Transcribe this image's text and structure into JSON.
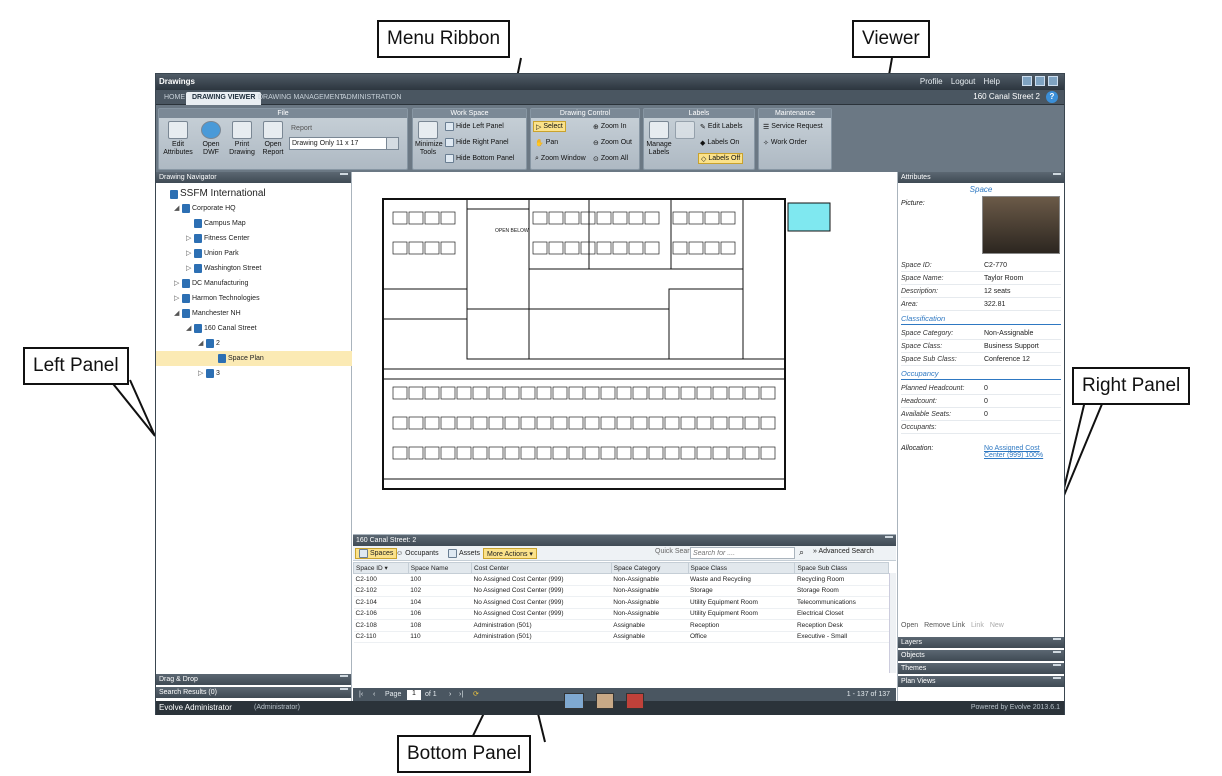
{
  "app": {
    "title": "Drawings",
    "top_links": [
      "Profile",
      "Logout",
      "Help"
    ],
    "tabs": [
      "Home",
      "Drawing Viewer",
      "Drawing Management",
      "Administration"
    ],
    "active_tab": "Drawing Viewer",
    "building_label": "160 Canal Street 2"
  },
  "ribbon": {
    "file": {
      "header": "File",
      "edit": "Edit Attributes",
      "open_dwf": "Open DWF",
      "print": "Print Drawing",
      "open_report": "Open Report",
      "report_label": "Report",
      "report_value": "Drawing Only 11 x 17"
    },
    "workspace": {
      "header": "Work Space",
      "minimize": "Minimize Tools",
      "hide_left": "Hide Left Panel",
      "hide_right": "Hide Right Panel",
      "hide_bottom": "Hide Bottom Panel"
    },
    "drawing_control": {
      "header": "Drawing Control",
      "select": "Select",
      "pan": "Pan",
      "zoom_window": "Zoom Window",
      "zoom_in": "Zoom In",
      "zoom_out": "Zoom Out",
      "zoom_all": "Zoom All"
    },
    "labels": {
      "header": "Labels",
      "manage": "Manage Labels",
      "edit": "Edit Labels",
      "on": "Labels On",
      "off": "Labels Off"
    },
    "maintenance": {
      "header": "Maintenance",
      "service": "Service Request",
      "work_order": "Work Order"
    }
  },
  "left_panel": {
    "header": "Drawing Navigator",
    "tree": [
      {
        "label": "SSFM International",
        "indent": 0,
        "tw": ""
      },
      {
        "label": "Corporate HQ",
        "indent": 1,
        "tw": "◢"
      },
      {
        "label": "Campus Map",
        "indent": 2,
        "tw": ""
      },
      {
        "label": "Fitness Center",
        "indent": 2,
        "tw": "▷"
      },
      {
        "label": "Union Park",
        "indent": 2,
        "tw": "▷"
      },
      {
        "label": "Washington Street",
        "indent": 2,
        "tw": "▷"
      },
      {
        "label": "DC Manufacturing",
        "indent": 1,
        "tw": "▷"
      },
      {
        "label": "Harmon Technologies",
        "indent": 1,
        "tw": "▷"
      },
      {
        "label": "Manchester NH",
        "indent": 1,
        "tw": "◢"
      },
      {
        "label": "160 Canal Street",
        "indent": 2,
        "tw": "◢"
      },
      {
        "label": "2",
        "indent": 3,
        "tw": "◢"
      },
      {
        "label": "Space Plan",
        "indent": 4,
        "tw": "",
        "selected": true
      },
      {
        "label": "3",
        "indent": 3,
        "tw": "▷"
      }
    ],
    "drag_drop": "Drag & Drop",
    "search_results": "Search Results (0)"
  },
  "bottom_panel": {
    "header": "160 Canal Street: 2",
    "tabs": [
      "Spaces",
      "Occupants",
      "Assets",
      "More Actions ▾"
    ],
    "quick_search_label": "Quick Search:",
    "quick_search_placeholder": "Search for ....",
    "advanced": "Advanced Search",
    "columns": [
      "Space ID ▾",
      "Space Name",
      "Cost Center",
      "Space Category",
      "Space Class",
      "Space Sub Class"
    ],
    "rows": [
      [
        "C2-100",
        "100",
        "No Assigned Cost Center (999)",
        "Non-Assignable",
        "Waste and Recycling",
        "Recycling Room"
      ],
      [
        "C2-102",
        "102",
        "No Assigned Cost Center (999)",
        "Non-Assignable",
        "Storage",
        "Storage Room"
      ],
      [
        "C2-104",
        "104",
        "No Assigned Cost Center (999)",
        "Non-Assignable",
        "Utility Equipment Room",
        "Telecommunications"
      ],
      [
        "C2-106",
        "106",
        "No Assigned Cost Center (999)",
        "Non-Assignable",
        "Utility Equipment Room",
        "Electrical Closet"
      ],
      [
        "C2-108",
        "108",
        "Administration (501)",
        "Assignable",
        "Reception",
        "Reception Desk"
      ],
      [
        "C2-110",
        "110",
        "Administration (501)",
        "Assignable",
        "Office",
        "Executive - Small"
      ]
    ],
    "page_label": "Page",
    "page_value": "1",
    "page_of": "of 1",
    "record_count": "1 - 137 of 137"
  },
  "right_panel": {
    "header": "Attributes",
    "object_title": "Space",
    "picture_label": "Picture:",
    "attributes": [
      {
        "k": "Space ID:",
        "v": "C2-770"
      },
      {
        "k": "Space Name:",
        "v": "Taylor Room"
      },
      {
        "k": "Description:",
        "v": "12 seats"
      },
      {
        "k": "Area:",
        "v": "322.81"
      }
    ],
    "classification_title": "Classification",
    "classification": [
      {
        "k": "Space Category:",
        "v": "Non-Assignable"
      },
      {
        "k": "Space Class:",
        "v": "Business Support"
      },
      {
        "k": "Space Sub Class:",
        "v": "Conference 12"
      }
    ],
    "occupancy_title": "Occupancy",
    "occupancy": [
      {
        "k": "Planned Headcount:",
        "v": "0"
      },
      {
        "k": "Headcount:",
        "v": "0"
      },
      {
        "k": "Available Seats:",
        "v": "0"
      },
      {
        "k": "Occupants:",
        "v": ""
      }
    ],
    "allocation_label": "Allocation:",
    "allocation_value": "No Assigned Cost Center (999) 100%",
    "actions": [
      "Open",
      "Remove Link",
      "Link",
      "New"
    ],
    "sections": [
      "Layers",
      "Objects",
      "Themes",
      "Plan Views"
    ]
  },
  "status": {
    "user": "Evolve Administrator",
    "role": "(Administrator)",
    "powered": "Powered by Evolve 2013.6.1"
  },
  "callouts": {
    "menu_ribbon": "Menu Ribbon",
    "viewer": "Viewer",
    "left_panel": "Left Panel",
    "right_panel": "Right Panel",
    "bottom_panel": "Bottom Panel"
  },
  "floor_plan": {
    "open_below": "OPEN BELOW",
    "highlight_color": "#7fe8f0"
  },
  "colors": {
    "accent": "#2e78c2",
    "highlight": "#fbe28a",
    "chrome": "#4a5661"
  }
}
